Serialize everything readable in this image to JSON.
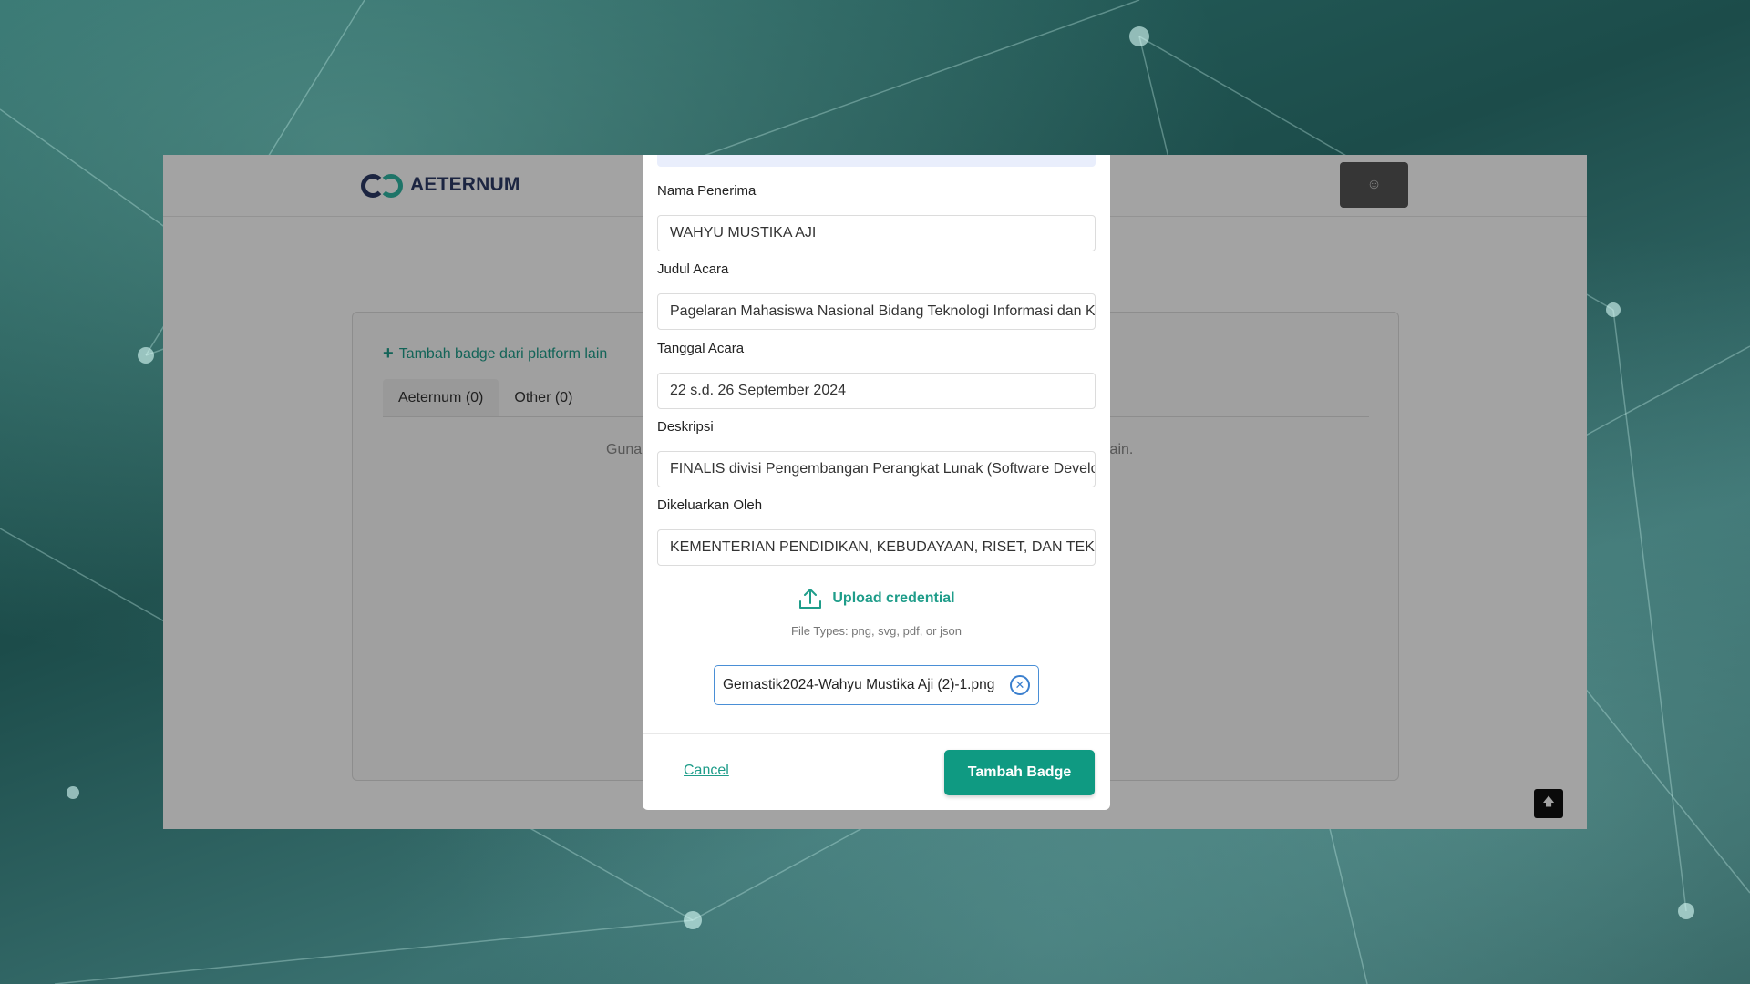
{
  "app": {
    "logo_text": "AETERNUM"
  },
  "page": {
    "add_badge_link": "Tambah badge dari platform lain",
    "tabs": [
      {
        "label": "Aeternum (0)",
        "active": true
      },
      {
        "label": "Other (0)",
        "active": false
      }
    ],
    "hint_left": "Guna",
    "hint_right": "lain."
  },
  "modal": {
    "fields": [
      {
        "label": "Nama Penerima",
        "value": "WAHYU MUSTIKA AJI"
      },
      {
        "label": "Judul Acara",
        "value": "Pagelaran Mahasiswa Nasional Bidang Teknologi Informasi dan Komunikasi"
      },
      {
        "label": "Tanggal Acara",
        "value": "22 s.d. 26 September 2024"
      },
      {
        "label": "Deskripsi",
        "value": "FINALIS divisi Pengembangan Perangkat Lunak (Software Development)"
      },
      {
        "label": "Dikeluarkan Oleh",
        "value": "KEMENTERIAN PENDIDIKAN, KEBUDAYAAN, RISET, DAN TEKNOLOGI"
      }
    ],
    "upload_label": "Upload credential",
    "file_types": "File Types: png, svg, pdf, or json",
    "uploaded_file": "Gemastik2024-Wahyu Mustika Aji (2)-1.png",
    "cancel_label": "Cancel",
    "submit_label": "Tambah Badge"
  },
  "colors": {
    "accent": "#0f9a82",
    "link": "#1f9d8a",
    "logo_dark": "#2d3a66",
    "file_chip_border": "#4a8fd6"
  },
  "icons": {
    "upload": "upload-icon",
    "remove_file": "close-circle-icon",
    "user_menu": "user-icon",
    "scroll_top": "arrow-up-icon",
    "add": "plus-icon"
  }
}
